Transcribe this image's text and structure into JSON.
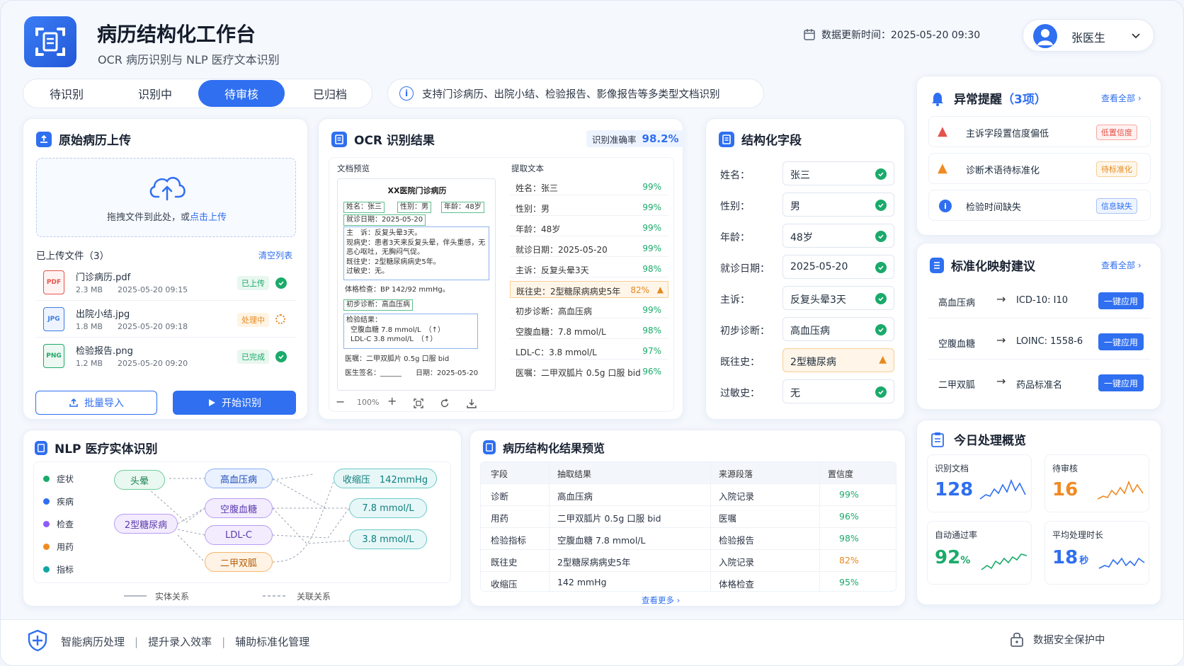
{
  "header": {
    "title": "病历结构化工作台",
    "subtitle": "OCR 病历识别与 NLP 医疗文本识别",
    "update_label": "数据更新时间：2025-05-20 09:30",
    "user": "张医生"
  },
  "tabs": [
    {
      "label": "待识别"
    },
    {
      "label": "识别中"
    },
    {
      "label": "待审核",
      "active": true
    },
    {
      "label": "已归档"
    }
  ],
  "info_bar": "支持门诊病历、出院小结、检验报告、影像报告等多类型文档识别",
  "upload": {
    "title": "原始病历上传",
    "drop_text": "拖拽文件到此处，或",
    "drop_link": "点击上传",
    "uploaded_label": "已上传文件（3）",
    "clear": "清空列表",
    "files": [
      {
        "ext": "PDF",
        "name": "门诊病历.pdf",
        "size": "2.3 MB",
        "time": "2025-05-20 09:15",
        "status": "已上传",
        "color": "#e5534b"
      },
      {
        "ext": "JPG",
        "name": "出院小结.jpg",
        "size": "1.8 MB",
        "time": "2025-05-20 09:18",
        "status": "处理中",
        "color": "#3d7be0"
      },
      {
        "ext": "PNG",
        "name": "检验报告.png",
        "size": "1.2 MB",
        "time": "2025-05-20 09:20",
        "status": "已完成",
        "color": "#20a868"
      }
    ],
    "batch_btn": "批量导入",
    "start_btn": "开始识别"
  },
  "ocr": {
    "title": "OCR 识别结果",
    "accuracy_label": "识别准确率",
    "accuracy": "98.2%",
    "preview_label": "文档预览",
    "extract_label": "提取文本",
    "doc": {
      "heading": "XX医院门诊病历",
      "name": "姓名：张三",
      "gender": "性别：男",
      "age": "年龄：48岁",
      "date": "就诊日期：2025-05-20",
      "complaint": "主　诉：反复头晕3天。",
      "history_now": "现病史：患者3天来反复头晕，伴头重感，无恶心呕吐，无胸闷气促。",
      "past": "既往史：2型糖尿病病史5年。",
      "allergy": "过敏史：无。",
      "exam": "体格检查：BP 142/92 mmHg。",
      "diag": "初步诊断：高血压病",
      "lab_title": "检验结果：",
      "lab1": "空腹血糖 7.8 mmol/L　（↑）",
      "lab2": "LDL-C  3.8 mmol/L　（↑）",
      "rx": "医嘱：二甲双胍片 0.5g 口服 bid",
      "sign": "医生签名：______　　日期：2025-05-20"
    },
    "zoom": "100%",
    "extracted": [
      {
        "text": "姓名：张三",
        "pct": "99%"
      },
      {
        "text": "性别：男",
        "pct": "99%"
      },
      {
        "text": "年龄：48岁",
        "pct": "99%"
      },
      {
        "text": "就诊日期：2025-05-20",
        "pct": "99%"
      },
      {
        "text": "主诉：反复头晕3天",
        "pct": "98%"
      },
      {
        "text": "既往史：2型糖尿病病史5年",
        "pct": "82%",
        "warn": true
      },
      {
        "text": "初步诊断：高血压病",
        "pct": "99%"
      },
      {
        "text": "空腹血糖：7.8 mmol/L",
        "pct": "98%"
      },
      {
        "text": "LDL-C：3.8 mmol/L",
        "pct": "97%"
      },
      {
        "text": "医嘱：二甲双胍片 0.5g 口服 bid",
        "pct": "96%"
      }
    ]
  },
  "fields": {
    "title": "结构化字段",
    "items": [
      {
        "label": "姓名：",
        "value": "张三"
      },
      {
        "label": "性别：",
        "value": "男"
      },
      {
        "label": "年龄：",
        "value": "48岁"
      },
      {
        "label": "就诊日期：",
        "value": "2025-05-20"
      },
      {
        "label": "主诉：",
        "value": "反复头晕3天"
      },
      {
        "label": "初步诊断：",
        "value": "高血压病"
      },
      {
        "label": "既往史：",
        "value": "2型糖尿病",
        "warn": true
      },
      {
        "label": "过敏史：",
        "value": "无"
      }
    ]
  },
  "alerts": {
    "title": "异常提醒",
    "count": "（3项）",
    "view_all": "查看全部",
    "items": [
      {
        "text": "主诉字段置信度偏低",
        "tag": "低置信度",
        "type": "red"
      },
      {
        "text": "诊断术语待标准化",
        "tag": "待标准化",
        "type": "orange"
      },
      {
        "text": "检验时间缺失",
        "tag": "信息缺失",
        "type": "blue"
      }
    ]
  },
  "mapping": {
    "title": "标准化映射建议",
    "view_all": "查看全部",
    "items": [
      {
        "from": "高血压病",
        "to": "ICD-10: I10",
        "btn": "一键应用"
      },
      {
        "from": "空腹血糖",
        "to": "LOINC: 1558-6",
        "btn": "一键应用"
      },
      {
        "from": "二甲双胍",
        "to": "药品标准名",
        "btn": "一键应用"
      }
    ]
  },
  "nlp": {
    "title": "NLP 医疗实体识别",
    "legend": [
      {
        "label": "症状",
        "color": "#1aaa6a"
      },
      {
        "label": "疾病",
        "color": "#2f6ff0"
      },
      {
        "label": "检查",
        "color": "#8b5cf6"
      },
      {
        "label": "用药",
        "color": "#f08a24"
      },
      {
        "label": "指标",
        "color": "#14a3a3"
      }
    ],
    "entities": {
      "dizzy": "头晕",
      "diabetes": "2型糖尿病",
      "hypertension": "高血压病",
      "glucose": "空腹血糖",
      "ldl": "LDL-C",
      "metformin": "二甲双胍",
      "sbp": "收缩压　142mmHg",
      "v1": "7.8 mmol/L",
      "v2": "3.8 mmol/L"
    },
    "line_solid": "实体关系",
    "line_dashed": "关联关系"
  },
  "preview": {
    "title": "病历结构化结果预览",
    "columns": [
      "字段",
      "抽取结果",
      "来源段落",
      "置信度"
    ],
    "rows": [
      {
        "field": "诊断",
        "result": "高血压病",
        "source": "入院记录",
        "conf": "99%"
      },
      {
        "field": "用药",
        "result": "二甲双胍片 0.5g 口服 bid",
        "source": "医嘱",
        "conf": "96%"
      },
      {
        "field": "检验指标",
        "result": "空腹血糖 7.8 mmol/L",
        "source": "检验报告",
        "conf": "98%"
      },
      {
        "field": "既往史",
        "result": "2型糖尿病病史5年",
        "source": "入院记录",
        "conf": "82%",
        "warn": true
      },
      {
        "field": "收缩压",
        "result": "142 mmHg",
        "source": "体格检查",
        "conf": "95%"
      }
    ],
    "more": "查看更多"
  },
  "overview": {
    "title": "今日处理概览",
    "stats": [
      {
        "label": "识别文档",
        "value": "128",
        "unit": "",
        "color": "#2f6ff0"
      },
      {
        "label": "待审核",
        "value": "16",
        "unit": "",
        "color": "#f08a24"
      },
      {
        "label": "自动通过率",
        "value": "92",
        "unit": "%",
        "color": "#1aaa6a"
      },
      {
        "label": "平均处理时长",
        "value": "18",
        "unit": "秒",
        "color": "#2f6ff0"
      }
    ]
  },
  "footer": {
    "items": [
      "智能病历处理",
      "提升录入效率",
      "辅助标准化管理"
    ],
    "security": "数据安全保护中"
  }
}
